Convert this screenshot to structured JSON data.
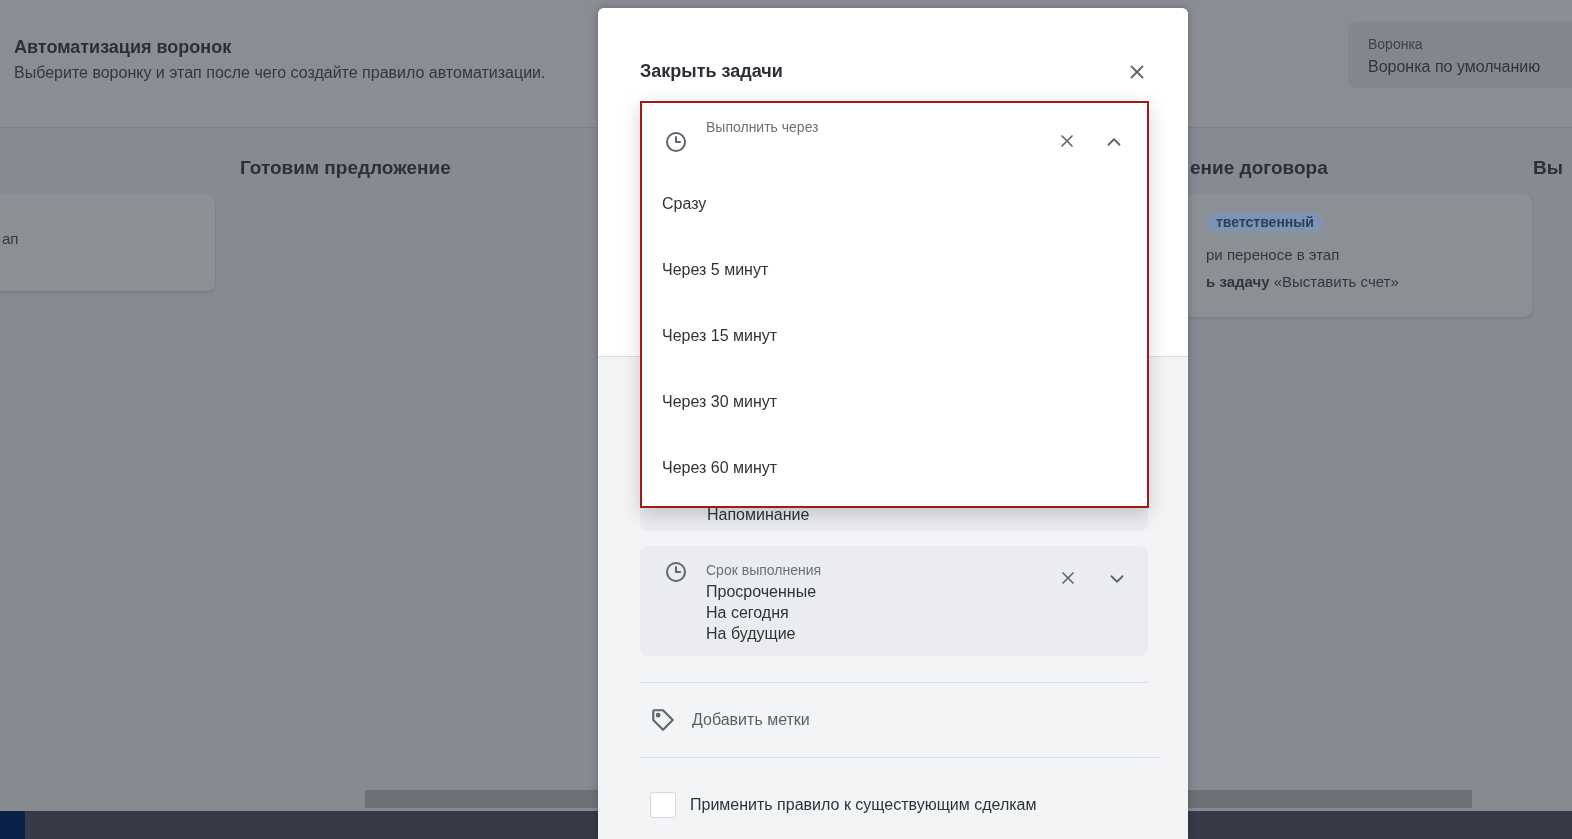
{
  "page": {
    "title": "Автоматизация воронок",
    "subtitle": "Выберите воронку и этап после чего создайте правило автоматизации.",
    "funnel": {
      "label": "Воронка",
      "value": "Воронка по умолчанию"
    }
  },
  "columns": [
    {
      "cards": [
        {
          "lines": [
            "ап"
          ]
        }
      ]
    },
    {
      "heading": "Готовим предложение"
    },
    {
      "heading": "ение договора",
      "cards": [
        {
          "badge": "тветственный",
          "lines": [
            "ри переносе в этап",
            "**ь задачу** «Выставить счет»"
          ]
        }
      ]
    },
    {
      "heading": "Вы"
    }
  ],
  "modal": {
    "title": "Закрыть задачи",
    "dropdown": {
      "label": "Выполнить через",
      "expanded": true,
      "options": [
        {
          "label": "Сразу",
          "selected": false
        },
        {
          "label": "Через 5 минут",
          "selected": false
        },
        {
          "label": "Через 15 минут",
          "selected": false
        },
        {
          "label": "Через 30 минут",
          "selected": false
        },
        {
          "label": "Через 60 минут",
          "selected": false
        }
      ]
    },
    "reminder": {
      "value": "Напоминание"
    },
    "deadline": {
      "label": "Срок выполнения",
      "expanded": false,
      "values": [
        "Просроченные",
        "На сегодня",
        "На будущие"
      ]
    },
    "tags": {
      "label": "Добавить метки"
    },
    "apply": {
      "label": "Применить правило к существующим сделкам",
      "checked": false
    }
  }
}
